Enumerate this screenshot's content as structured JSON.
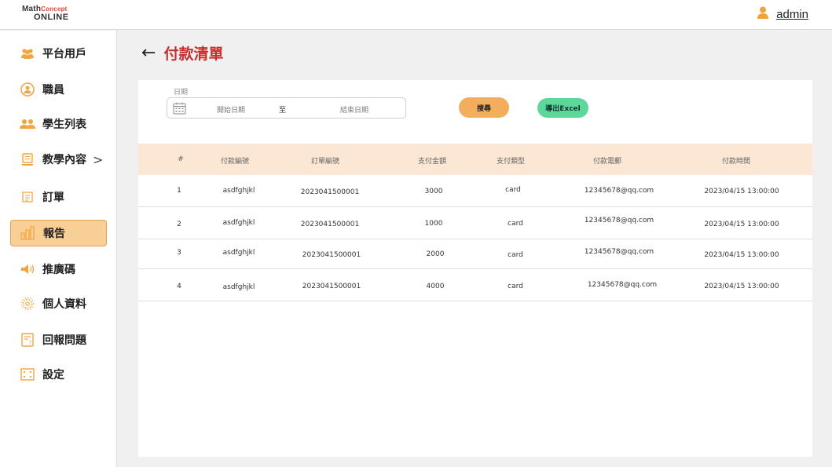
{
  "header": {
    "logo_top_math": "Math",
    "logo_top_concept": "Concept",
    "logo_bottom": "ONLINE",
    "user_name": "admin",
    "user_icon": "person-icon",
    "accent": "#f2ae5c"
  },
  "sidebar": {
    "items": [
      {
        "label": "平台用戶",
        "icon": "users-icon"
      },
      {
        "label": "職員",
        "icon": "staff-icon"
      },
      {
        "label": "學生列表",
        "icon": "students-icon"
      },
      {
        "label": "教學內容",
        "icon": "book-icon",
        "chevron": ">"
      },
      {
        "label": "訂單",
        "icon": "order-icon"
      },
      {
        "label": "報告",
        "icon": "bar-chart-icon",
        "active": true
      },
      {
        "label": "推廣碼",
        "icon": "megaphone-icon"
      },
      {
        "label": "個人資料",
        "icon": "gear-icon"
      },
      {
        "label": "回報問題",
        "icon": "question-doc-icon"
      },
      {
        "label": "設定",
        "icon": "settings-frame-icon"
      }
    ],
    "active_color": "#f7cf97"
  },
  "main": {
    "back_arrow": "←",
    "title": "付款清單",
    "title_color": "#c62f2f"
  },
  "filters": {
    "date_label": "日期",
    "start_placeholder": "開始日期",
    "to": "至",
    "end_placeholder": "結束日期",
    "search_button": "搜尋",
    "export_button": "導出Excel"
  },
  "table": {
    "columns": [
      "#",
      "付款編號",
      "訂單編號",
      "支付金額",
      "支付類型",
      "付款電郵",
      "付款時間"
    ],
    "rows": [
      [
        "1",
        "asdfghjkl",
        "2023041500001",
        "3000",
        "card",
        "12345678@qq.com",
        "2023/04/15 13:00:00"
      ],
      [
        "2",
        "asdfghjkl",
        "2023041500001",
        "1000",
        "card",
        "12345678@qq.com",
        "2023/04/15 13:00:00"
      ],
      [
        "3",
        "asdfghjkl",
        "2023041500001",
        "2000",
        "card",
        "12345678@qq.com",
        "2023/04/15 13:00:00"
      ],
      [
        "4",
        "asdfghjkl",
        "2023041500001",
        "4000",
        "card",
        "12345678@qq.com",
        "2023/04/15 13:00:00"
      ]
    ]
  }
}
